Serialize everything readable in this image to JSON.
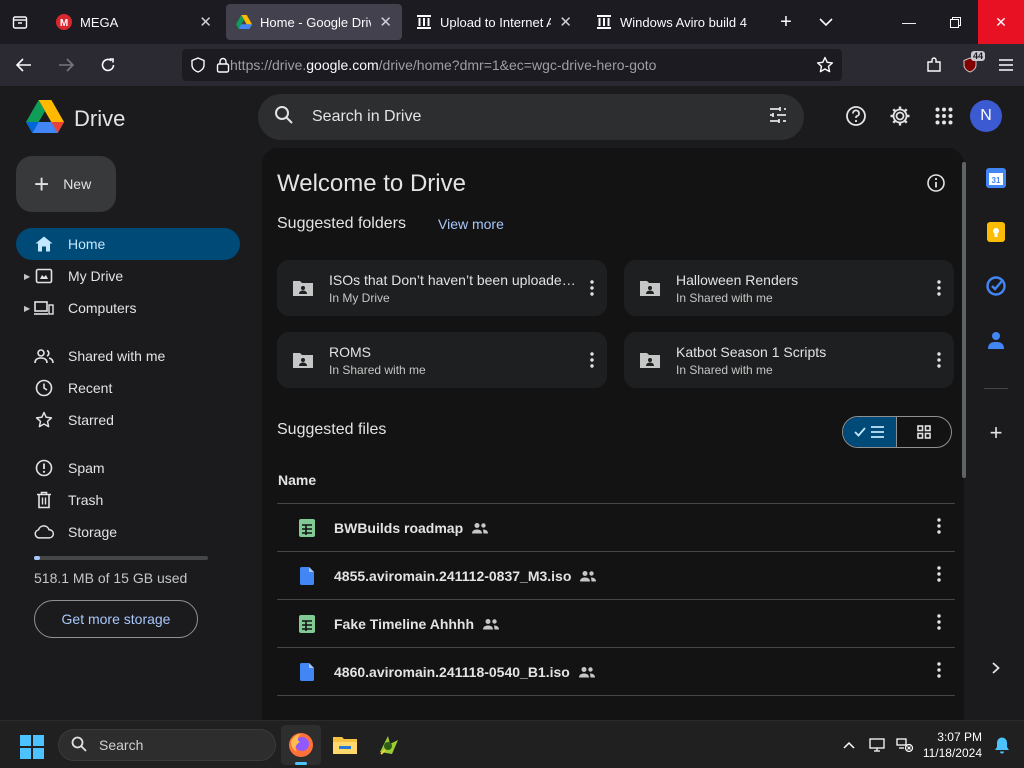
{
  "browser": {
    "tabs": [
      {
        "title": "MEGA",
        "active": false
      },
      {
        "title": "Home - Google Drive",
        "active": true
      },
      {
        "title": "Upload to Internet Arci",
        "active": false
      },
      {
        "title": "Windows Aviro build 4",
        "active": false
      }
    ],
    "url_prefix": "https://drive.",
    "url_domain": "google.com",
    "url_suffix": "/drive/home?dmr=1&ec=wgc-drive-hero-goto",
    "extension_badge": "44"
  },
  "drive": {
    "app_name": "Drive",
    "search_placeholder": "Search in Drive",
    "avatar_letter": "N",
    "new_label": "New",
    "nav": [
      {
        "label": "Home",
        "icon": "home-icon",
        "active": true
      },
      {
        "label": "My Drive",
        "icon": "my-drive-icon",
        "expandable": true
      },
      {
        "label": "Computers",
        "icon": "computers-icon",
        "expandable": true
      },
      {
        "label": "Shared with me",
        "icon": "shared-icon"
      },
      {
        "label": "Recent",
        "icon": "clock-icon"
      },
      {
        "label": "Starred",
        "icon": "star-icon"
      },
      {
        "label": "Spam",
        "icon": "spam-icon"
      },
      {
        "label": "Trash",
        "icon": "trash-icon"
      },
      {
        "label": "Storage",
        "icon": "cloud-icon"
      }
    ],
    "storage_text": "518.1 MB of 15 GB used",
    "storage_fraction": 0.034,
    "get_storage_label": "Get more storage",
    "welcome_title": "Welcome to Drive",
    "suggested_folders_title": "Suggested folders",
    "view_more_label": "View more",
    "folders": [
      {
        "name": "ISOs that Don’t haven’t been uploaded...",
        "location": "In My Drive"
      },
      {
        "name": "Halloween Renders",
        "location": "In Shared with me"
      },
      {
        "name": "ROMS",
        "location": "In Shared with me"
      },
      {
        "name": "Katbot Season 1 Scripts",
        "location": "In Shared with me"
      }
    ],
    "suggested_files_title": "Suggested files",
    "name_header": "Name",
    "files": [
      {
        "name": "BWBuilds roadmap",
        "type": "sheet"
      },
      {
        "name": "4855.aviromain.241112-0837_M3.iso",
        "type": "doc"
      },
      {
        "name": "Fake Timeline Ahhhh",
        "type": "sheet"
      },
      {
        "name": "4860.aviromain.241118-0540_B1.iso",
        "type": "doc"
      }
    ]
  },
  "taskbar": {
    "search_label": "Search",
    "time": "3:07 PM",
    "date": "11/18/2024"
  },
  "colors": {
    "accent": "#a8c7fa",
    "active_nav": "#004a77",
    "sheet_green": "#81c995",
    "doc_blue": "#4285f4",
    "close_red": "#e81123"
  }
}
